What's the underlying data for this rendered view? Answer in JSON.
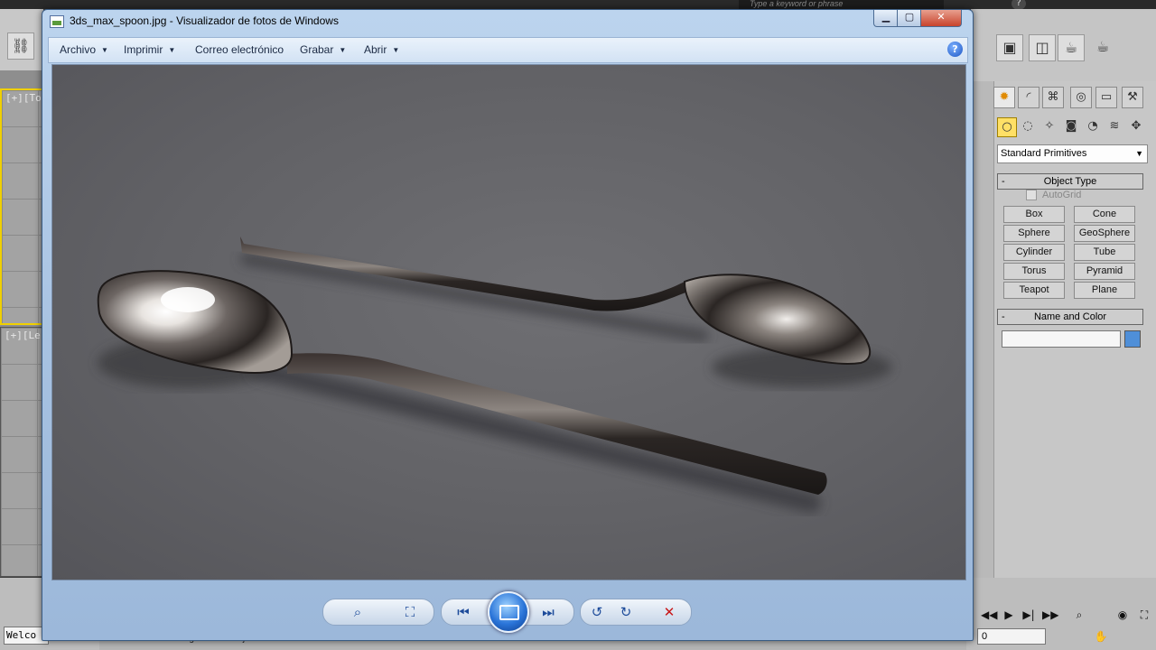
{
  "max_app": {
    "search_placeholder": "Type a keyword or phrase",
    "viewport_top_label": "[+][To",
    "viewport_left_label": "[+][Le",
    "welcome_text": "Welco",
    "status_message": "Click or click-and-drag to select objects",
    "frame_value": "0",
    "create_dropdown": "Standard Primitives",
    "object_type_title": "Object Type",
    "autogrid_label": "AutoGrid",
    "object_buttons": [
      "Box",
      "Cone",
      "Sphere",
      "GeoSphere",
      "Cylinder",
      "Tube",
      "Torus",
      "Pyramid",
      "Teapot",
      "Plane"
    ],
    "name_color_title": "Name and Color",
    "swatch_color": "#4f8fd8"
  },
  "viewer": {
    "title": "3ds_max_spoon.jpg - Visualizador de fotos de Windows",
    "menu": [
      "Archivo",
      "Imprimir",
      "Correo electrónico",
      "Grabar",
      "Abrir"
    ],
    "menu_has_caret": [
      true,
      true,
      false,
      true,
      true
    ],
    "help_icon": "?",
    "image_description": "two-silver-spoons",
    "controls": [
      "zoom-icon",
      "fit-window-icon",
      "previous-icon",
      "slideshow-icon",
      "next-icon",
      "rotate-left-icon",
      "rotate-right-icon",
      "delete-icon"
    ]
  }
}
